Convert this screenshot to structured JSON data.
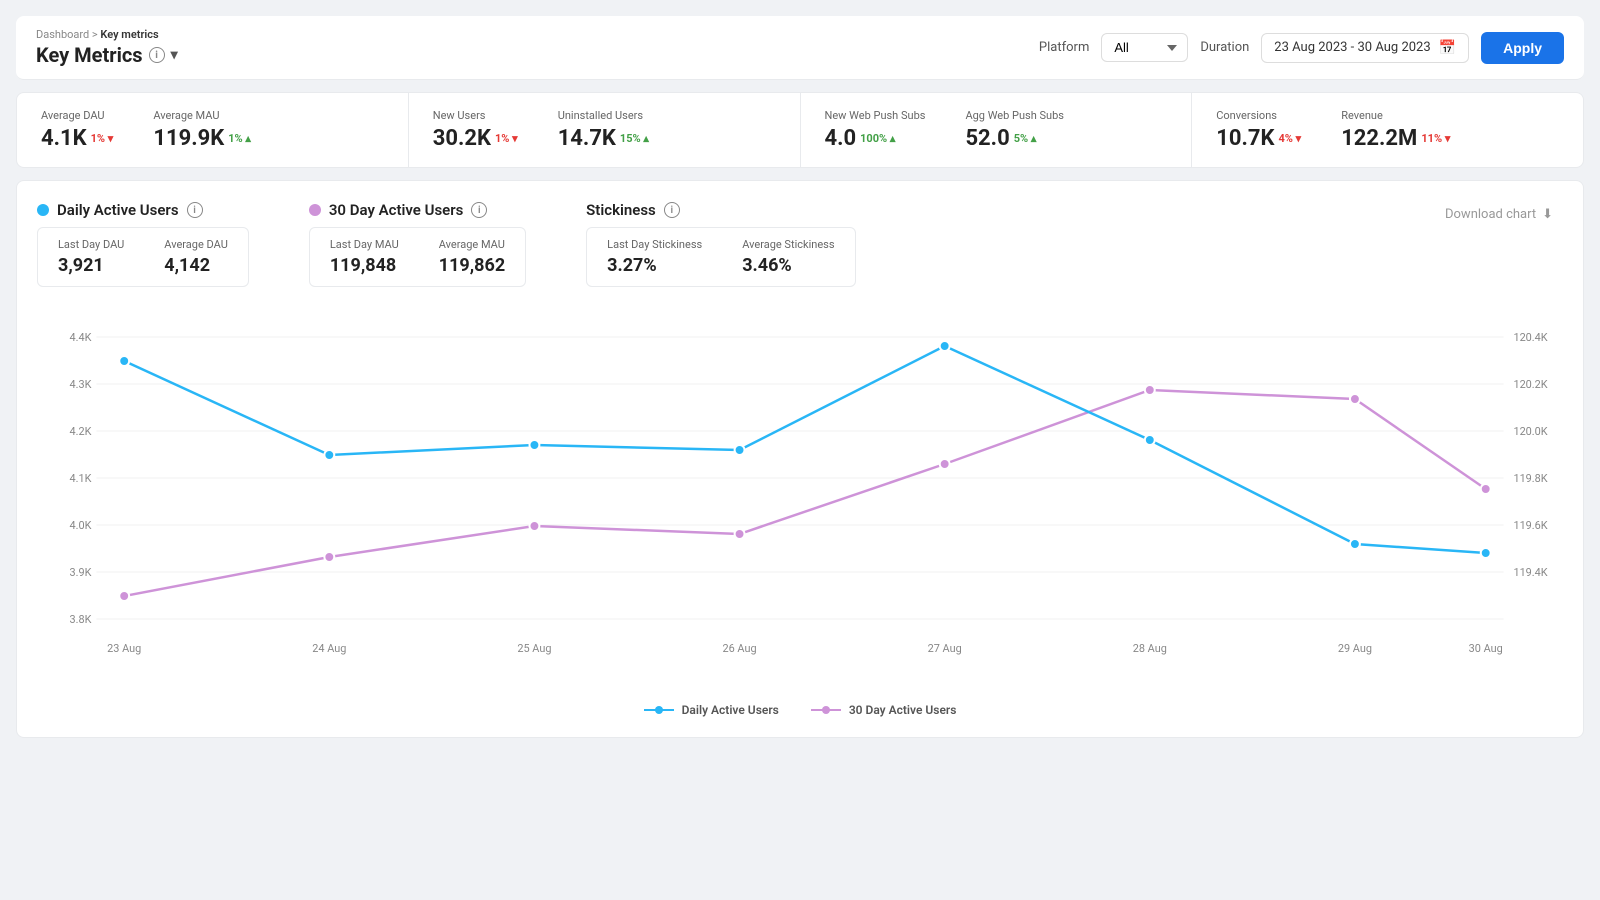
{
  "breadcrumb": {
    "parent": "Dashboard",
    "current": "Key metrics"
  },
  "page": {
    "title": "Key Metrics"
  },
  "controls": {
    "platform_label": "Platform",
    "platform_value": "All",
    "duration_label": "Duration",
    "duration_value": "23 Aug 2023 - 30 Aug 2023",
    "apply_label": "Apply"
  },
  "metrics": [
    {
      "group": "group1",
      "items": [
        {
          "label": "Average DAU",
          "value": "4.1K",
          "change": "1%",
          "direction": "down"
        },
        {
          "label": "Average MAU",
          "value": "119.9K",
          "change": "1%",
          "direction": "up"
        }
      ]
    },
    {
      "group": "group2",
      "items": [
        {
          "label": "New Users",
          "value": "30.2K",
          "change": "1%",
          "direction": "down"
        },
        {
          "label": "Uninstalled Users",
          "value": "14.7K",
          "change": "15%",
          "direction": "up"
        }
      ]
    },
    {
      "group": "group3",
      "items": [
        {
          "label": "New Web Push Subs",
          "value": "4.0",
          "change": "100%",
          "direction": "up"
        },
        {
          "label": "Agg Web Push Subs",
          "value": "52.0",
          "change": "5%",
          "direction": "up"
        }
      ]
    },
    {
      "group": "group4",
      "items": [
        {
          "label": "Conversions",
          "value": "10.7K",
          "change": "4%",
          "direction": "down"
        },
        {
          "label": "Revenue",
          "value": "122.2M",
          "change": "11%",
          "direction": "down"
        }
      ]
    }
  ],
  "chart_sections": {
    "dau": {
      "title": "Daily Active Users",
      "last_day_label": "Last Day DAU",
      "last_day_value": "3,921",
      "avg_label": "Average DAU",
      "avg_value": "4,142"
    },
    "mau": {
      "title": "30 Day Active Users",
      "last_day_label": "Last Day MAU",
      "last_day_value": "119,848",
      "avg_label": "Average MAU",
      "avg_value": "119,862"
    },
    "stickiness": {
      "title": "Stickiness",
      "last_day_label": "Last Day Stickiness",
      "last_day_value": "3.27%",
      "avg_label": "Average Stickiness",
      "avg_value": "3.46%"
    }
  },
  "download_chart_label": "Download chart",
  "legend": {
    "dau_label": "Daily Active Users",
    "mau_label": "30 Day Active Users"
  },
  "chart_dates": [
    "23 Aug",
    "24 Aug",
    "25 Aug",
    "26 Aug",
    "27 Aug",
    "28 Aug",
    "29 Aug",
    "30 Aug"
  ],
  "dau_left_axis": [
    "4.4K",
    "4.3K",
    "4.2K",
    "4.1K",
    "4.0K",
    "3.9K",
    "3.8K"
  ],
  "mau_right_axis": [
    "120.4K",
    "120.2K",
    "120.0K",
    "119.8K",
    "119.6K",
    "119.4K"
  ]
}
